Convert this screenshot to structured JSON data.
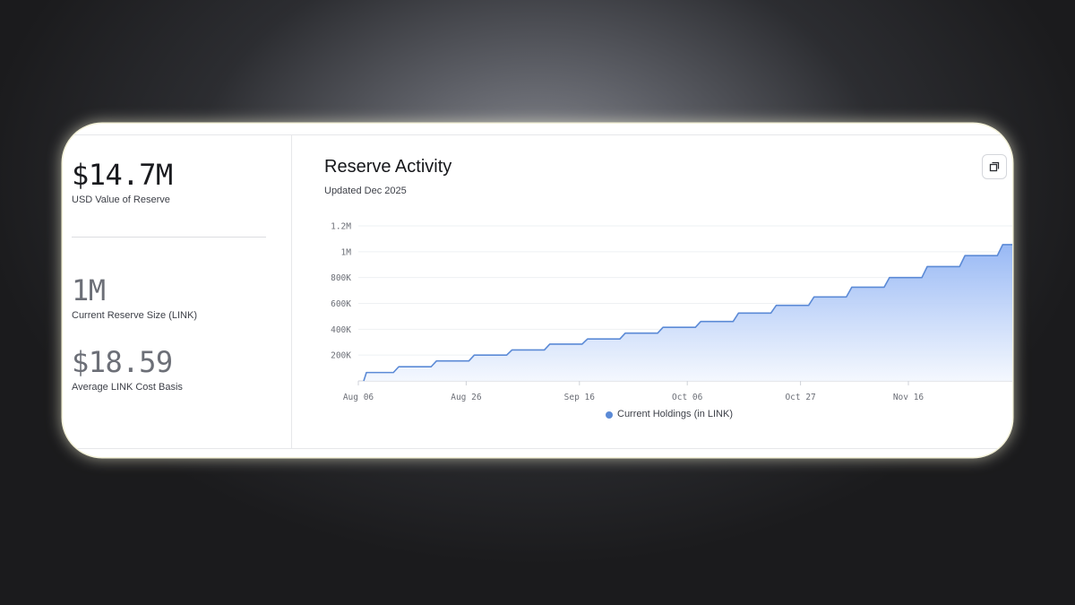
{
  "stats": {
    "usd_value": "$14.7M",
    "usd_label": "USD Value of Reserve",
    "reserve_size": "1M",
    "reserve_size_label": "Current Reserve Size (LINK)",
    "cost_basis": "$18.59",
    "cost_basis_label": "Average LINK Cost Basis"
  },
  "header": {
    "title": "Reserve Activity",
    "subtitle": "Updated Dec 2025",
    "expand_icon": "expand-icon"
  },
  "colors": {
    "line": "#5b8ad6",
    "fill_top": "#93b5f4",
    "fill_bottom": "#f3f7fe",
    "grid": "#eef0f3",
    "legend_dot": "#5b8ad6"
  },
  "chart_data": {
    "type": "area",
    "title": "Reserve Activity",
    "subtitle": "Updated Dec 2025",
    "xlabel": "",
    "ylabel": "",
    "x_ticks": [
      "Aug 06",
      "Aug 26",
      "Sep 16",
      "Oct 06",
      "Oct 27",
      "Nov 16"
    ],
    "y_ticks": [
      "200K",
      "400K",
      "600K",
      "800K",
      "1M",
      "1.2M"
    ],
    "ylim": [
      0,
      1200000
    ],
    "xlim": [
      "2025-08-06",
      "2025-12-05"
    ],
    "grid": true,
    "legend_position": "bottom-center",
    "series": [
      {
        "name": "Current Holdings (in LINK)",
        "step": true,
        "x": [
          "2025-08-07",
          "2025-08-13",
          "2025-08-20",
          "2025-08-27",
          "2025-09-03",
          "2025-09-10",
          "2025-09-17",
          "2025-09-24",
          "2025-10-01",
          "2025-10-08",
          "2025-10-15",
          "2025-10-22",
          "2025-10-29",
          "2025-11-05",
          "2025-11-12",
          "2025-11-19",
          "2025-11-26",
          "2025-12-03",
          "2025-12-05"
        ],
        "values": [
          65000,
          110000,
          155000,
          200000,
          240000,
          285000,
          325000,
          370000,
          415000,
          460000,
          525000,
          585000,
          650000,
          725000,
          800000,
          885000,
          970000,
          1055000,
          1055000
        ]
      }
    ]
  }
}
